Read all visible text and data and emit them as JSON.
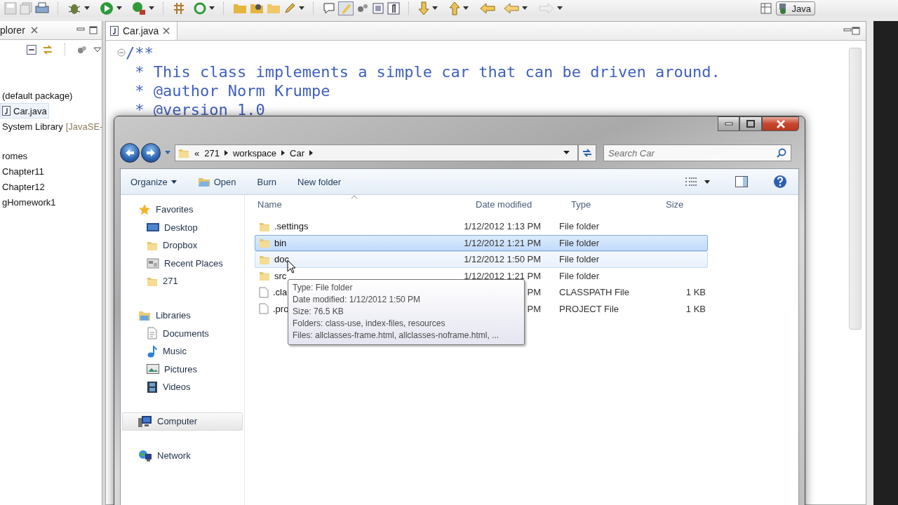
{
  "ide": {
    "toolbar": {
      "perspective": "Java"
    },
    "package_explorer": {
      "tab": "plorer",
      "tree": [
        {
          "label": "(default package)",
          "kind": "package",
          "selected": false
        },
        {
          "label": "Car.java",
          "kind": "java-file",
          "selected": true
        },
        {
          "label": "System Library",
          "detail": "[JavaSE-",
          "kind": "library",
          "selected": false
        },
        {
          "label": "romes",
          "kind": "project",
          "selected": false
        },
        {
          "label": "Chapter11",
          "kind": "project",
          "selected": false
        },
        {
          "label": "Chapter12",
          "kind": "project",
          "selected": false
        },
        {
          "label": "gHomework1",
          "kind": "project",
          "selected": false
        }
      ]
    },
    "editor": {
      "tab": "Car.java",
      "lines": [
        "/**",
        " * This class implements a simple car that can be driven around.",
        " * @author Norm Krumpe",
        " * @version 1.0"
      ]
    }
  },
  "explorer": {
    "address": {
      "overflow": "«",
      "crumbs": [
        "271",
        "workspace",
        "Car"
      ]
    },
    "search": {
      "placeholder": "Search Car"
    },
    "commands": [
      {
        "label": "Organize",
        "kind": "menu"
      },
      {
        "label": "Open",
        "kind": "icon"
      },
      {
        "label": "Burn",
        "kind": "plain"
      },
      {
        "label": "New folder",
        "kind": "plain"
      }
    ],
    "nav": [
      {
        "label": "Favorites",
        "kind": "favorites",
        "hovered": false,
        "children": [
          {
            "label": "Desktop",
            "kind": "desktop",
            "hovered": false
          },
          {
            "label": "Dropbox",
            "kind": "folder",
            "hovered": false
          },
          {
            "label": "Recent Places",
            "kind": "recent",
            "hovered": false
          },
          {
            "label": "271",
            "kind": "folder",
            "hovered": false
          }
        ]
      },
      {
        "label": "Libraries",
        "kind": "libraries",
        "hovered": false,
        "children": [
          {
            "label": "Documents",
            "kind": "documents",
            "hovered": false
          },
          {
            "label": "Music",
            "kind": "music",
            "hovered": false
          },
          {
            "label": "Pictures",
            "kind": "pictures",
            "hovered": false
          },
          {
            "label": "Videos",
            "kind": "videos",
            "hovered": false
          }
        ]
      },
      {
        "label": "Computer",
        "kind": "computer",
        "hovered": true
      },
      {
        "label": "Network",
        "kind": "network",
        "hovered": false
      }
    ],
    "columns": [
      "Name",
      "Date modified",
      "Type",
      "Size"
    ],
    "files": [
      {
        "name": ".settings",
        "date": "1/12/2012 1:13 PM",
        "type": "File folder",
        "kind": "folder",
        "selected": false,
        "hovered": false
      },
      {
        "name": "bin",
        "date": "1/12/2012 1:21 PM",
        "type": "File folder",
        "kind": "folder",
        "selected": true,
        "hovered": false
      },
      {
        "name": "doc",
        "date": "1/12/2012 1:50 PM",
        "type": "File folder",
        "kind": "folder",
        "selected": false,
        "hovered": true
      },
      {
        "name": "src",
        "date": "1/12/2012 1:21 PM",
        "type": "File folder",
        "kind": "folder",
        "selected": false,
        "hovered": false
      },
      {
        "name": ".cla",
        "date": "PM",
        "type": "CLASSPATH File",
        "size": "1 KB",
        "kind": "file",
        "selected": false,
        "hovered": false
      },
      {
        "name": ".pro",
        "date": "PM",
        "type": "PROJECT File",
        "size": "1 KB",
        "kind": "file",
        "selected": false,
        "hovered": false
      }
    ],
    "tooltip": [
      "Type: File folder",
      "Date modified: 1/12/2012 1:50 PM",
      "Size: 76.5 KB",
      "Folders: class-use, index-files, resources",
      "Files: allclasses-frame.html, allclasses-noframe.html, ..."
    ]
  }
}
